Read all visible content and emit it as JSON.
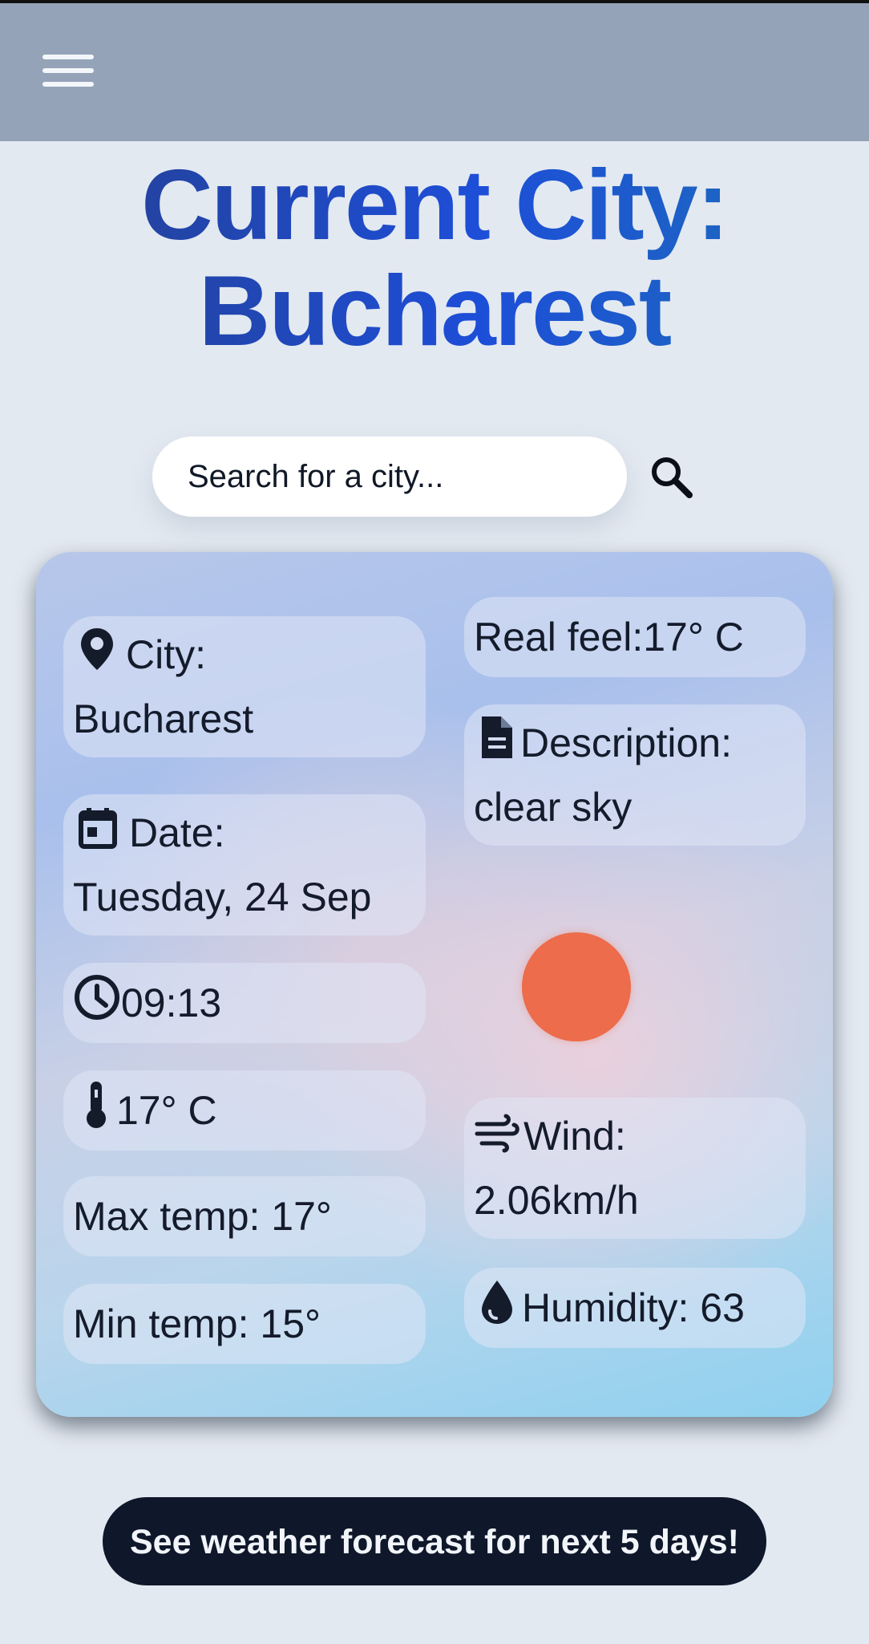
{
  "header": {
    "menu_icon": "hamburger-menu-icon"
  },
  "title": {
    "line1": "Current City:",
    "line2": "Bucharest"
  },
  "search": {
    "placeholder": "Search for a city...",
    "value": "",
    "icon": "search-icon"
  },
  "weather": {
    "city_label": "City:",
    "city_value": "Bucharest",
    "date_label": "Date:",
    "date_value": "Tuesday, 24 Sep",
    "time": "09:13",
    "temperature": "17° C",
    "max_temp": "Max temp: 17°",
    "min_temp": "Min temp: 15°",
    "real_feel": "Real feel:17° C",
    "description_label": "Description:",
    "description_value": "clear sky",
    "wind_label": "Wind:",
    "wind_value": "2.06km/h",
    "humidity": "Humidity: 63",
    "weather_icon": "sun-icon",
    "sun_color": "#ec6c4b"
  },
  "forecast_button": {
    "label": "See weather forecast for next 5 days!"
  },
  "colors": {
    "header_bg": "#94a3b8",
    "page_bg": "#e3e9f1",
    "title_gradient": [
      "#263f8c",
      "#1d4ed8",
      "#1d6fb8"
    ],
    "button_bg": "#0f172a"
  }
}
